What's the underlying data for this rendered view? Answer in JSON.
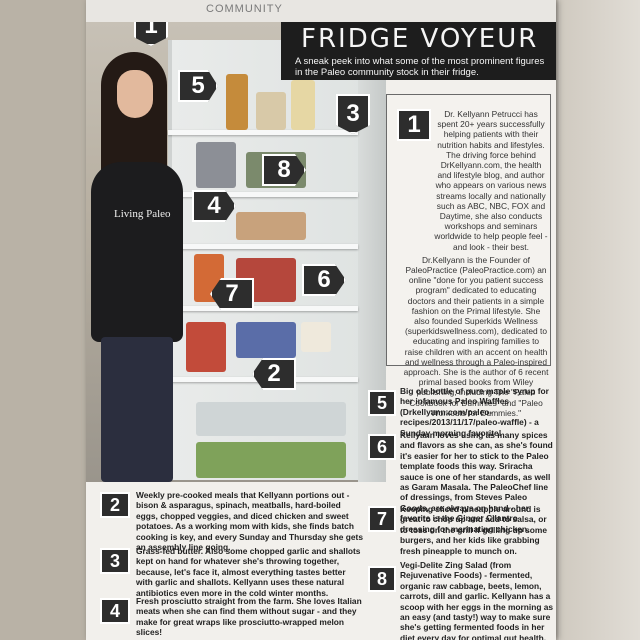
{
  "page": {
    "section_label": "COMMUNITY",
    "title": "FRIDGE VOYEUR",
    "subtitle": "A sneak peek into what some of the most prominent figures in the Paleo community stock in their fridge."
  },
  "photo": {
    "shirt_text": "Living Paleo",
    "callouts": [
      "1",
      "5",
      "3",
      "8",
      "4",
      "6",
      "7",
      "2"
    ]
  },
  "bio": {
    "number": "1",
    "paragraph1": "Dr. Kellyann Petrucci has spent 20+ years successfully helping patients with their nutrition habits and lifestyles. The driving force behind DrKellyann.com, the health and lifestyle blog, and author who appears on various news streams locally and nationally such as ABC, NBC, FOX and Daytime, she also conducts workshops and seminars worldwide to help people feel - and look - their best.",
    "paragraph2": "Dr.Kellyann is the Founder of PaleoPractice (PaleoPractice.com) an online \"done for you patient success program\" dedicated to educating doctors and their patients in a simple fashion on the Primal lifestyle. She also founded Superkids Wellness (superkidswellness.com), dedicated to educating and inspiring families to raise children with an accent on health and wellness through a Paleo-inspired approach. She is the author of 6 recent primal based books from Wiley publishing, including The \"Paleo Cookbook for Dummies\" and \"Paleo Workouts for Dummies.\""
  },
  "items_right": [
    {
      "number": "5",
      "text": "Big ole bottle of pure maple syrup for her infamous Paleo Waffles (Drkellyann.com/paleo-recipes/2013/11/17/paleo-waffle) - a Sunday morning favorite!"
    },
    {
      "number": "6",
      "text": "Kellyann loves using as many spices and flavors as she can, as she's found it's easier for her to stick to the Paleo template foods this way. Sriracha sauce is one of her standards, as well as Garam Masala. The PaleoChef line of dressings, from Steves Paleo Goods, are always on hand - her favorite is the Ginger Cilantro dressing for marinating chicken."
    },
    {
      "number": "7",
      "text": "Keeping sliced pineapple around is great to chop up and add to salsa, or to toss on the grill if grilling up some burgers, and her kids like grabbing fresh pineapple to munch on."
    },
    {
      "number": "8",
      "text": "Vegi-Delite Zing Salad (from Rejuvenative Foods) - fermented, organic raw cabbage, beets, lemon, carrots, dill and garlic. Kellyann has a scoop with her eggs in the morning as an easy (and tasty!) way to make sure she's getting fermented foods in her diet every day for optimal gut health."
    }
  ],
  "items_left": [
    {
      "number": "2",
      "text": "Weekly pre-cooked meals that Kellyann portions out - bison & asparagus, spinach, meatballs, hard-boiled eggs, chopped veggies, and diced chicken and sweet potatoes. As a working mom with kids, she finds batch cooking is key, and every Sunday and Thursday she gets an assembly line going."
    },
    {
      "number": "3",
      "text": "Grass-fed butter. Also some chopped garlic and shallots kept on hand for whatever she's throwing together, because, let's face it, almost everything tastes better with garlic and shallots. Kellyann uses these natural antibiotics even more in the cold winter months."
    },
    {
      "number": "4",
      "text": "Fresh prosciutto straight from the farm. She loves Italian meats when she can find them without sugar - and they make for great wraps like prosciutto-wrapped melon slices!"
    }
  ],
  "colors": {
    "badge": "#2d2d2d",
    "title_bg": "#1d1d1d",
    "page": "#f2f0ec"
  }
}
